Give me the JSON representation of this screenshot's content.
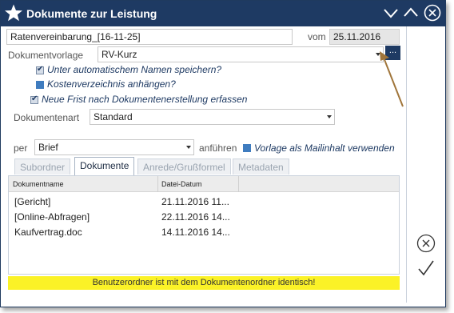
{
  "window": {
    "title": "Dokumente zur Leistung"
  },
  "form": {
    "document_name": "Ratenvereinbarung_[16-11-25]",
    "vom_label": "vom",
    "vom_date": "25.11.2016",
    "template_label": "Dokumentvorlage",
    "template_value": "RV-Kurz",
    "browse_label": "...",
    "opt_auto_name": "Unter automatischem Namen speichern?",
    "opt_cost_dir": "Kostenverzeichnis anhängen?",
    "opt_new_deadline": "Neue Frist nach Dokumentenerstellung erfassen",
    "doctype_label": "Dokumentenart",
    "doctype_value": "Standard",
    "per_label": "per",
    "per_value": "Brief",
    "anfuehren_label": "anführen",
    "mail_template_label": "Vorlage als Mailinhalt verwenden"
  },
  "tabs": [
    "Subordner",
    "Dokumente",
    "Anrede/Grußformel",
    "Metadaten"
  ],
  "list": {
    "columns": [
      "Dokumentname",
      "Datei-Datum"
    ],
    "rows": [
      {
        "name": "[Gericht]",
        "date": "21.11.2016 11..."
      },
      {
        "name": "[Online-Abfragen]",
        "date": "22.11.2016 14..."
      },
      {
        "name": "Kaufvertrag.doc",
        "date": "14.11.2016 14..."
      }
    ]
  },
  "status": "Benutzerordner ist mit dem Dokumentenordner identisch!",
  "colors": {
    "titlebar": "#1e3a63",
    "status_bg": "#fbf227",
    "checkbox_blue": "#3f7cbf",
    "annotation_arrow": "#a0753a"
  }
}
